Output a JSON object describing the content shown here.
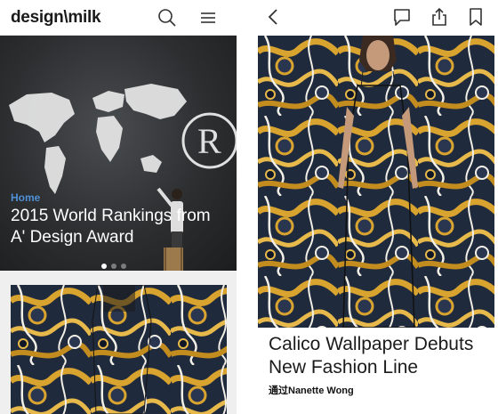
{
  "left_screen": {
    "logo": "design\\milk",
    "hero": {
      "category": "Home",
      "title": "2015 World Rankings from A' Design Award",
      "slide_index": 0,
      "slide_count": 3
    }
  },
  "right_screen": {
    "article": {
      "title": "Calico Wallpaper Debuts New Fashion Line",
      "byline": "通过Nanette Wong"
    }
  },
  "icons": {
    "search": "search-icon",
    "menu": "hamburger-menu-icon",
    "back": "chevron-left-icon",
    "comment": "comment-icon",
    "share": "share-icon",
    "bookmark": "bookmark-icon"
  },
  "colors": {
    "accent_blue": "#4e8fd6",
    "marble_gold": "#d9a32f",
    "marble_navy": "#1f2a3d",
    "marble_white": "#f2efe6"
  }
}
